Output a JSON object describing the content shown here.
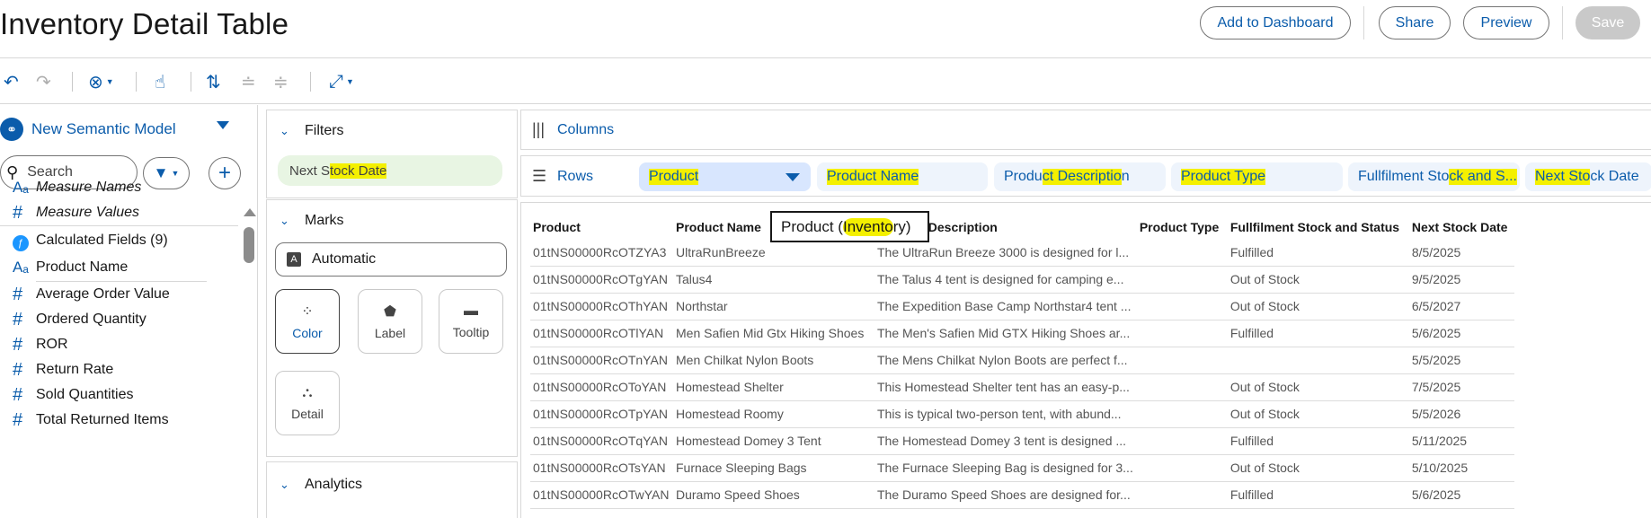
{
  "header": {
    "title": "Inventory Detail Table",
    "add_to_dashboard": "Add to Dashboard",
    "share": "Share",
    "preview": "Preview",
    "save": "Save"
  },
  "toolbar": {
    "icons": [
      "undo-icon",
      "redo-icon",
      "clear-icon",
      "pin-icon",
      "swap-icon",
      "sort-ascending-icon",
      "sort-descending-icon",
      "fit-icon"
    ]
  },
  "data_panel": {
    "model_name": "New Semantic Model",
    "search_placeholder": "Search",
    "fields": [
      {
        "type": "text",
        "name": "Measure Names",
        "italic": true
      },
      {
        "type": "number",
        "name": "Measure Values",
        "italic": true
      },
      {
        "type": "calc",
        "name": "Calculated Fields (9)"
      },
      {
        "type": "text",
        "name": "Product Name"
      },
      {
        "type": "number",
        "name": "Average Order Value"
      },
      {
        "type": "number",
        "name": "Ordered Quantity"
      },
      {
        "type": "number",
        "name": "ROR"
      },
      {
        "type": "number",
        "name": "Return Rate"
      },
      {
        "type": "number",
        "name": "Sold Quantities"
      },
      {
        "type": "number",
        "name": "Total Returned Items"
      }
    ]
  },
  "filters": {
    "title": "Filters",
    "pill_prefix": "Next S",
    "pill_highlight": "tock Date"
  },
  "marks": {
    "title": "Marks",
    "type": "Automatic",
    "buttons": [
      "Color",
      "Label",
      "Tooltip",
      "Detail"
    ]
  },
  "analytics": {
    "title": "Analytics"
  },
  "columns_shelf": {
    "label": "Columns"
  },
  "rows_shelf": {
    "label": "Rows",
    "pills": [
      {
        "pre": "",
        "hl": "Product",
        "post": ""
      },
      {
        "pre": "",
        "hl": "Product Name",
        "post": ""
      },
      {
        "pre": "Produ",
        "hl": "ct Descriptio",
        "post": "n"
      },
      {
        "pre": "",
        "hl": "Product Type",
        "post": ""
      },
      {
        "pre": "Fullfilment Sto",
        "hl": "ck and S...",
        "post": ""
      },
      {
        "pre": "",
        "hl": "Next Sto",
        "post": "ck Date"
      }
    ]
  },
  "table": {
    "columns": [
      "Product",
      "Product Name",
      "Product Description",
      "Product Type",
      "Fullfilment Stock and Status",
      "Next Stock Date"
    ],
    "rows": [
      [
        "01tNS00000RcOTZYA3",
        "UltraRunBreeze",
        "The UltraRun Breeze 3000 is designed for l...",
        "",
        "Fulfilled",
        "8/5/2025"
      ],
      [
        "01tNS00000RcOTgYAN",
        "Talus4",
        "The Talus 4 tent is designed for camping e...",
        "",
        "Out of Stock",
        "9/5/2025"
      ],
      [
        "01tNS00000RcOThYAN",
        "Northstar",
        "The Expedition Base Camp Northstar4 tent ...",
        "",
        "Out of Stock",
        "6/5/2027"
      ],
      [
        "01tNS00000RcOTlYAN",
        "Men Safien Mid Gtx Hiking Shoes",
        "The Men's Safien Mid GTX Hiking Shoes ar...",
        "",
        "Fulfilled",
        "5/6/2025"
      ],
      [
        "01tNS00000RcOTnYAN",
        "Men Chilkat Nylon Boots",
        "The Mens Chilkat Nylon Boots are perfect f...",
        "",
        "",
        "5/5/2025"
      ],
      [
        "01tNS00000RcOToYAN",
        "Homestead Shelter",
        "This Homestead Shelter tent has an easy-p...",
        "",
        "Out of Stock",
        "7/5/2025"
      ],
      [
        "01tNS00000RcOTpYAN",
        "Homestead Roomy",
        "This is typical two-person tent, with abund...",
        "",
        "Out of Stock",
        "5/5/2026"
      ],
      [
        "01tNS00000RcOTqYAN",
        "Homestead Domey 3 Tent",
        "The Homestead Domey 3 tent is designed ...",
        "",
        "Fulfilled",
        "5/11/2025"
      ],
      [
        "01tNS00000RcOTsYAN",
        "Furnace Sleeping Bags",
        "The Furnace Sleeping Bag is designed for 3...",
        "",
        "Out of Stock",
        "5/10/2025"
      ],
      [
        "01tNS00000RcOTwYAN",
        "Duramo Speed Shoes",
        "The Duramo Speed Shoes are designed for...",
        "",
        "Fulfilled",
        "5/6/2025"
      ]
    ]
  },
  "tooltip": {
    "pre": "Product (",
    "hl": "Invento",
    "post": "ry)"
  },
  "colors": {
    "accent": "#0b5cab",
    "highlight": "#f4f000",
    "filter_pill": "#e8f5e3",
    "row_pill": "#eef4fc"
  }
}
